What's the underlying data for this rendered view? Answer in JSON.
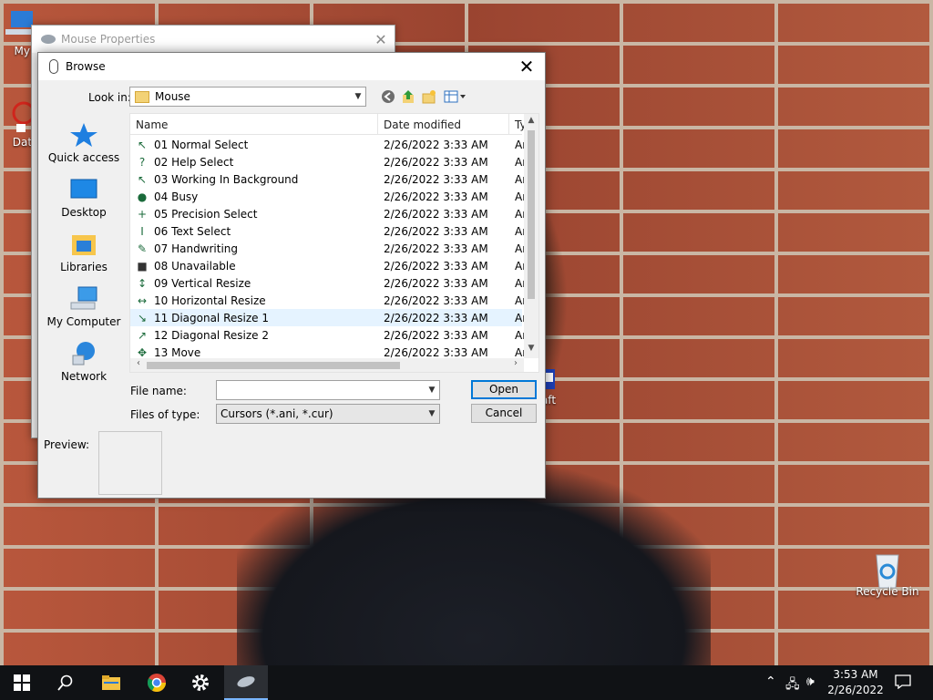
{
  "desktop": {
    "icons": [
      {
        "label": "My Co"
      },
      {
        "label": "DataW"
      },
      {
        "label": "aft"
      },
      {
        "label": "Recycle Bin"
      }
    ]
  },
  "mouse_properties": {
    "title": "Mouse Properties",
    "close": "✕"
  },
  "browse": {
    "title": "Browse",
    "close": "✕",
    "look_in_label": "Look in:",
    "look_in_value": "Mouse",
    "places": [
      {
        "label": "Quick access",
        "icon": "star-icon"
      },
      {
        "label": "Desktop",
        "icon": "desktop-icon"
      },
      {
        "label": "Libraries",
        "icon": "libraries-icon"
      },
      {
        "label": "My Computer",
        "icon": "computer-icon"
      },
      {
        "label": "Network",
        "icon": "network-icon"
      }
    ],
    "columns": {
      "name": "Name",
      "date": "Date modified",
      "type": "Ty"
    },
    "files": [
      {
        "name": "01 Normal Select",
        "date": "2/26/2022 3:33 AM",
        "type": "Ar"
      },
      {
        "name": "02 Help Select",
        "date": "2/26/2022 3:33 AM",
        "type": "Ar"
      },
      {
        "name": "03 Working In Background",
        "date": "2/26/2022 3:33 AM",
        "type": "Ar"
      },
      {
        "name": "04 Busy",
        "date": "2/26/2022 3:33 AM",
        "type": "Ar"
      },
      {
        "name": "05 Precision Select",
        "date": "2/26/2022 3:33 AM",
        "type": "Ar"
      },
      {
        "name": "06 Text Select",
        "date": "2/26/2022 3:33 AM",
        "type": "Ar"
      },
      {
        "name": "07 Handwriting",
        "date": "2/26/2022 3:33 AM",
        "type": "Ar"
      },
      {
        "name": "08 Unavailable",
        "date": "2/26/2022 3:33 AM",
        "type": "Ar"
      },
      {
        "name": "09 Vertical Resize",
        "date": "2/26/2022 3:33 AM",
        "type": "Ar"
      },
      {
        "name": "10 Horizontal Resize",
        "date": "2/26/2022 3:33 AM",
        "type": "Ar"
      },
      {
        "name": "11 Diagonal Resize 1",
        "date": "2/26/2022 3:33 AM",
        "type": "Ar"
      },
      {
        "name": "12 Diagonal Resize 2",
        "date": "2/26/2022 3:33 AM",
        "type": "Ar"
      },
      {
        "name": "13 Move",
        "date": "2/26/2022 3:33 AM",
        "type": "Ar"
      }
    ],
    "file_name_label": "File name:",
    "file_name_value": "",
    "file_type_label": "Files of type:",
    "file_type_value": "Cursors (*.ani, *.cur)",
    "open_label": "Open",
    "cancel_label": "Cancel",
    "preview_label": "Preview:"
  },
  "taskbar": {
    "time": "3:53 AM",
    "date": "2/26/2022"
  },
  "colors": {
    "accent": "#0078d7",
    "selected_row": "#e5f3ff",
    "taskbar": "#101215"
  }
}
